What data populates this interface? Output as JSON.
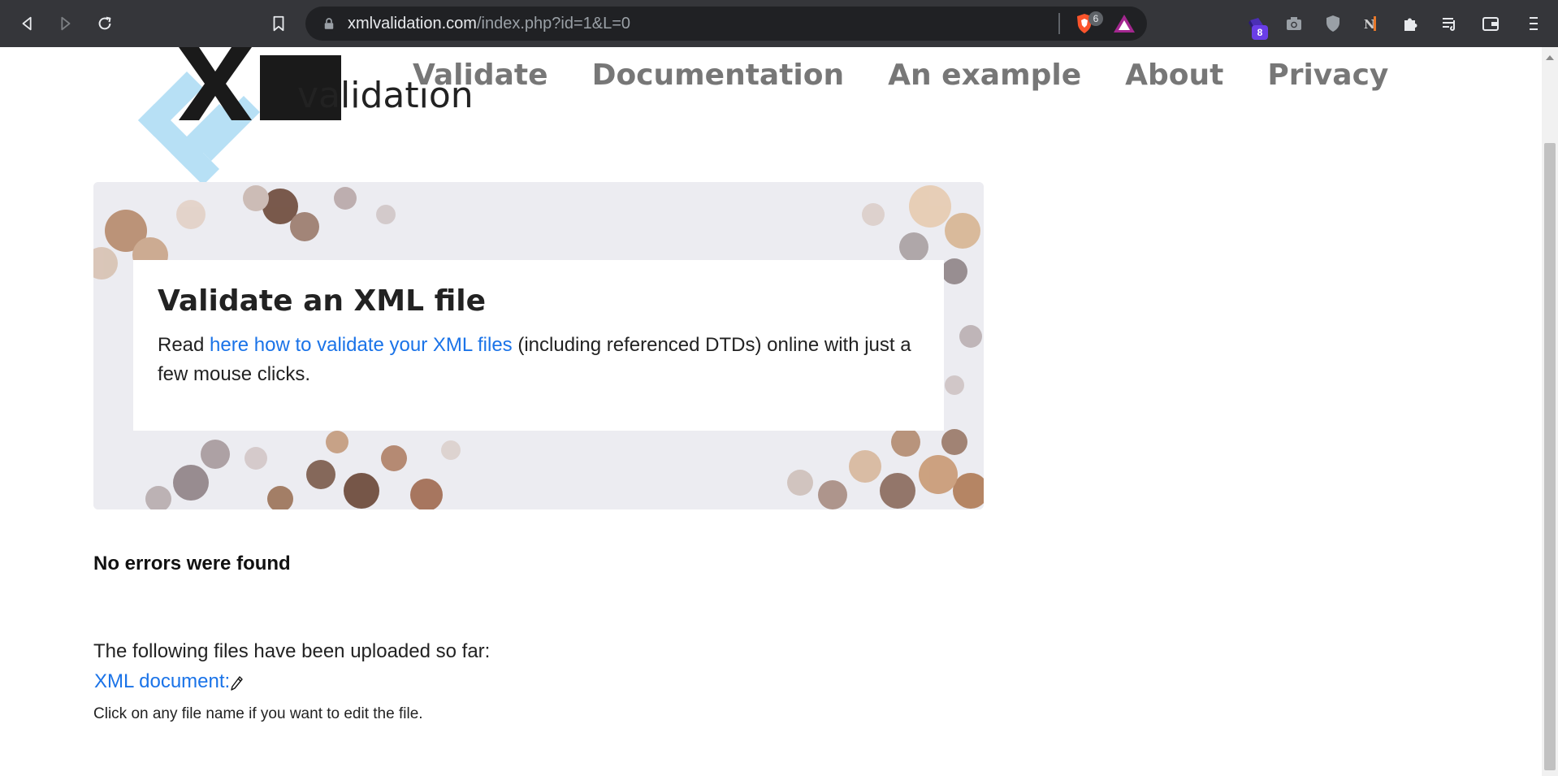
{
  "browser": {
    "url_host": "xmlvalidation.com",
    "url_path": "/index.php?id=1&L=0",
    "shield_count": "6",
    "extension_badge": "8",
    "icons": [
      "back-icon",
      "forward-icon",
      "reload-icon",
      "bookmark-icon",
      "lock-icon",
      "brave-shield-icon",
      "brave-rewards-icon",
      "extension-icon",
      "camera-icon",
      "shield-icon",
      "nj-extension-icon",
      "puzzle-icon",
      "playlist-icon",
      "wallet-icon",
      "menu-icon"
    ]
  },
  "site": {
    "logo_text": "validation",
    "logo_glyph": "xml",
    "nav": [
      {
        "label": "Validate"
      },
      {
        "label": "Documentation"
      },
      {
        "label": "An example"
      },
      {
        "label": "About"
      },
      {
        "label": "Privacy"
      }
    ]
  },
  "hero": {
    "title": "Validate an XML file",
    "text_before": "Read ",
    "link_text": "here how to validate your XML files",
    "text_after": " (including referenced DTDs) online with just a few mouse clicks."
  },
  "result": {
    "message": "No errors were found"
  },
  "files": {
    "intro": "The following files have been uploaded so far:",
    "file_link": "XML document:",
    "hint": "Click on any file name if you want to edit the file."
  },
  "colors": {
    "toolbar_bg": "#35363a",
    "url_bg": "#202124",
    "link": "#1a73e8",
    "nav": "#777777",
    "logo_blue": "#b7e0f5"
  }
}
